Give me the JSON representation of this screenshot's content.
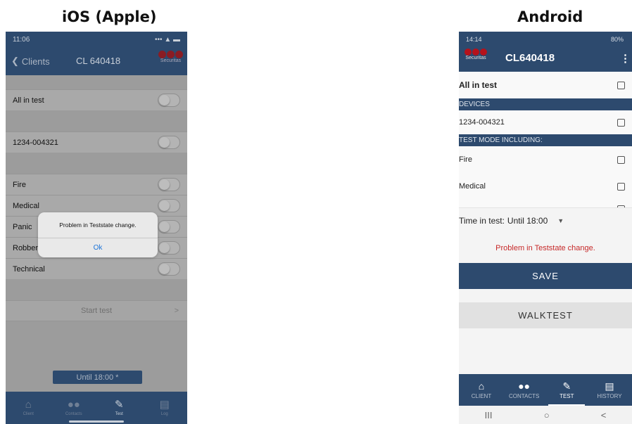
{
  "headings": {
    "ios": "iOS (Apple)",
    "android": "Android"
  },
  "ios": {
    "status_time": "11:06",
    "status_icons": "••• ▲ ▬",
    "back_label": "Clients",
    "title": "CL 640418",
    "logo_text": "Securitas",
    "rows": {
      "all_in_test": "All in test",
      "device": "1234-004321",
      "fire": "Fire",
      "medical": "Medical",
      "panic": "Panic",
      "robbery": "Robbery",
      "technical": "Technical"
    },
    "start_test": "Start test",
    "chevron": ">",
    "until": "Until 18:00 *",
    "alert": {
      "message": "Problem in Teststate change.",
      "ok": "Ok"
    },
    "tabs": {
      "client": "Client",
      "contacts": "Contacts",
      "test": "Test",
      "log": "Log"
    },
    "icons": {
      "client": "home-icon",
      "contacts": "contacts-icon",
      "test": "pen-icon",
      "log": "clipboard-icon"
    }
  },
  "android": {
    "status_time": "14:14",
    "status_right": "80%",
    "title": "CL640418",
    "logo_text": "Securitas",
    "menu": "⋮",
    "all_in_test": "All in test",
    "section_devices": "DEVICES",
    "device": "1234-004321",
    "section_test_mode": "TEST MODE INCLUDING:",
    "fire": "Fire",
    "medical": "Medical",
    "time_label": "Time in test:",
    "time_value": "Until 18:00",
    "error": "Problem in Teststate change.",
    "save": "SAVE",
    "walktest": "WALKTEST",
    "tabs": {
      "client": "CLIENT",
      "contacts": "CONTACTS",
      "test": "TEST",
      "history": "HISTORY"
    },
    "sysnav": {
      "recents": "III",
      "home": "○",
      "back": "<"
    }
  },
  "colors": {
    "brand_navy": "#2d4a6e",
    "brand_red": "#b5121b",
    "error_red": "#c62828",
    "ios_link": "#1a73d9"
  }
}
